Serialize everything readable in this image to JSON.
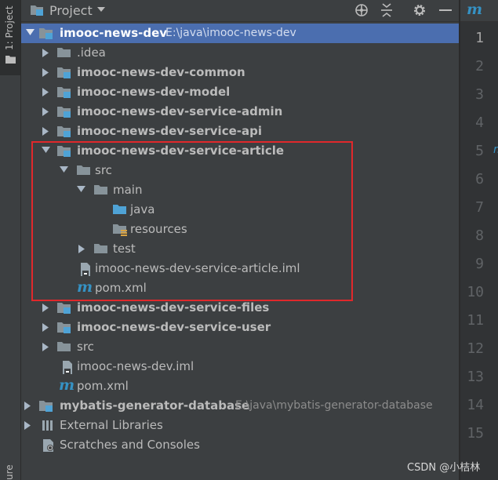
{
  "sidebar": {
    "tool_window_label": "1: Project",
    "bottom_label": "ure"
  },
  "header": {
    "title": "Project"
  },
  "editor": {
    "tab_glyph": "m",
    "edge_glyph": "m",
    "line_numbers": [
      "1",
      "2",
      "3",
      "4",
      "5",
      "6",
      "7",
      "8",
      "9",
      "10",
      "11",
      "12",
      "13",
      "14",
      "15"
    ]
  },
  "tree": {
    "root": {
      "name": "imooc-news-dev",
      "path": "E:\\java\\imooc-news-dev"
    },
    "idea": ".idea",
    "common": "imooc-news-dev-common",
    "model": "imooc-news-dev-model",
    "service_admin": "imooc-news-dev-service-admin",
    "service_api": "imooc-news-dev-service-api",
    "service_article": "imooc-news-dev-service-article",
    "article_src": "src",
    "article_main": "main",
    "article_java": "java",
    "article_resources": "resources",
    "article_test": "test",
    "article_iml": "imooc-news-dev-service-article.iml",
    "article_pom": "pom.xml",
    "service_files": "imooc-news-dev-service-files",
    "service_user": "imooc-news-dev-service-user",
    "root_src": "src",
    "root_iml": "imooc-news-dev.iml",
    "root_pom": "pom.xml",
    "mybatis": {
      "name": "mybatis-generator-database",
      "path": "E:\\java\\mybatis-generator-database"
    },
    "external_libraries": "External Libraries",
    "scratches": "Scratches and Consoles"
  },
  "watermark": "CSDN @小桔林",
  "colors": {
    "background": "#3c3f41",
    "selection": "#4b6eaf",
    "highlight_box": "#e0282b",
    "folder": "#87939a",
    "source_folder": "#4fa3d6",
    "maven": "#3592c4"
  },
  "icons": [
    "project-folder-icon",
    "module-folder-icon",
    "folder-icon",
    "source-folder-icon",
    "resources-folder-icon",
    "iml-file-icon",
    "maven-pom-icon",
    "library-icon",
    "scratches-icon",
    "globe-icon",
    "collapse-icon",
    "gear-icon",
    "minimize-icon"
  ]
}
